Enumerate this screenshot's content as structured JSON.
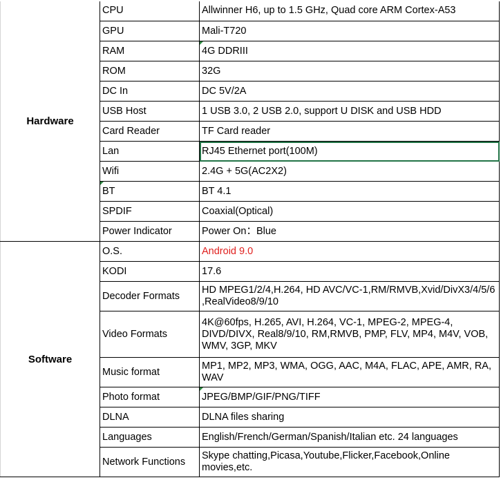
{
  "sections": [
    {
      "category": "Hardware",
      "rows": [
        {
          "label": "CPU",
          "value": "Allwinner H6, up to 1.5 GHz, Quad core ARM Cortex-A53"
        },
        {
          "label": "GPU",
          "value": "Mali-T720"
        },
        {
          "label": "RAM",
          "value": "4G DDRIII"
        },
        {
          "label": "ROM",
          "value": "32G"
        },
        {
          "label": "DC In",
          "value": "DC 5V/2A"
        },
        {
          "label": "USB Host",
          "value": "1 USB 3.0, 2  USB 2.0, support U DISK and USB HDD"
        },
        {
          "label": "Card Reader",
          "value": "TF Card reader"
        },
        {
          "label": "Lan",
          "value": "RJ45 Ethernet port(100M)"
        },
        {
          "label": "Wifi",
          "value": "2.4G + 5G(AC2X2)"
        },
        {
          "label": "BT",
          "value": "BT 4.1"
        },
        {
          "label": "SPDIF",
          "value": "Coaxial(Optical)"
        },
        {
          "label": "Power Indicator",
          "value": "Power On：Blue"
        }
      ]
    },
    {
      "category": "Software",
      "rows": [
        {
          "label": "O.S.",
          "value": "Android 9.0"
        },
        {
          "label": "KODI",
          "value": "17.6"
        },
        {
          "label": "Decoder Formats",
          "value": "HD MPEG1/2/4,H.264, HD AVC/VC-1,RM/RMVB,Xvid/DivX3/4/5/6 ,RealVideo8/9/10"
        },
        {
          "label": "Video Formats",
          "value": "4K@60fps, H.265, AVI, H.264, VC-1, MPEG-2, MPEG-4, DIVD/DIVX, Real8/9/10, RM,RMVB, PMP, FLV, MP4, M4V, VOB, WMV, 3GP, MKV"
        },
        {
          "label": "Music format",
          "value": "MP1, MP2, MP3, WMA, OGG, AAC, M4A, FLAC, APE, AMR, RA, WAV"
        },
        {
          "label": "Photo format",
          "value": "JPEG/BMP/GIF/PNG/TIFF"
        },
        {
          "label": "DLNA",
          "value": "DLNA files sharing"
        },
        {
          "label": "Languages",
          "value": "English/French/German/Spanish/Italian etc. 24 languages"
        },
        {
          "label": "Network Functions",
          "value": "Skype chatting,Picasa,Youtube,Flicker,Facebook,Online movies,etc."
        }
      ]
    }
  ],
  "colors": {
    "value_highlight": "#e0201e",
    "selection": "#217346",
    "comment_marker": "#2f8a43"
  }
}
